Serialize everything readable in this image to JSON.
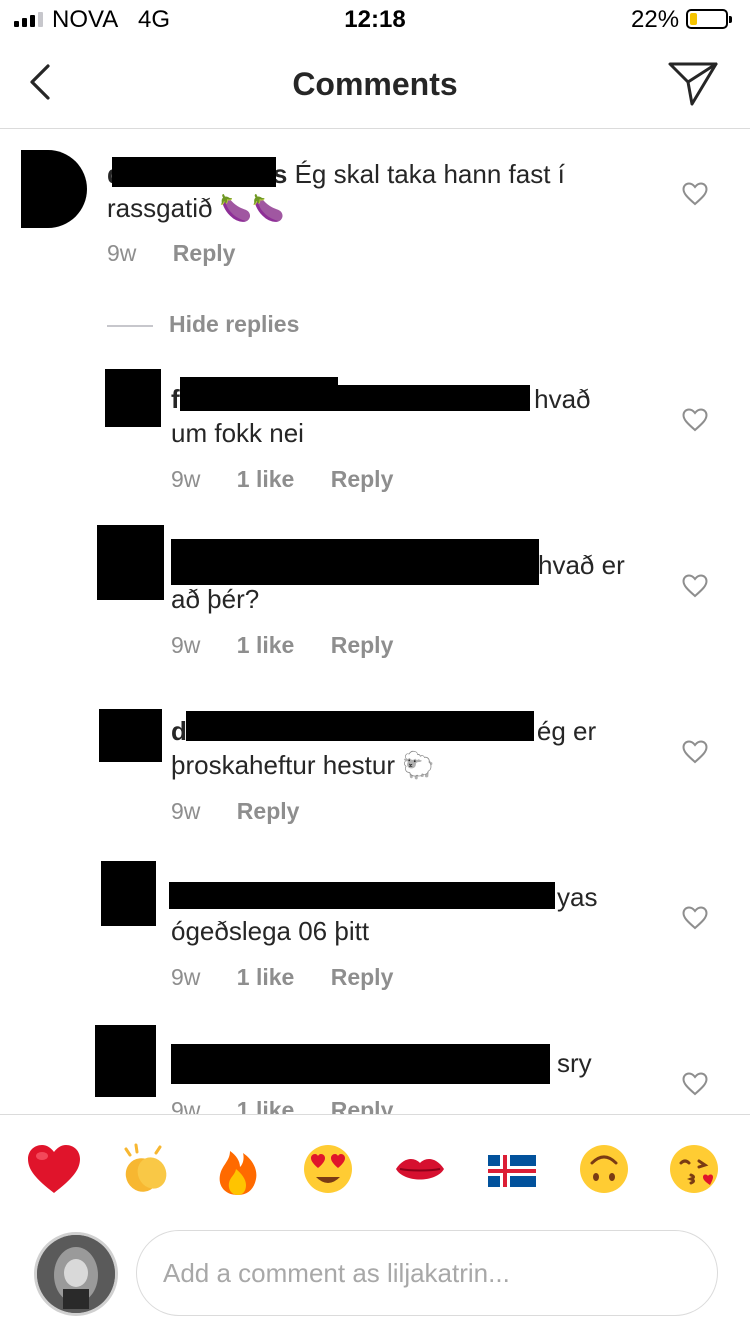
{
  "status_bar": {
    "carrier": "NOVA",
    "network": "4G",
    "time": "12:18",
    "battery_percent_label": "22%",
    "battery_level": 0.22,
    "battery_color": "#f5c400"
  },
  "header": {
    "title": "Comments",
    "back_icon": "chevron-left-icon",
    "share_icon": "paper-plane-icon"
  },
  "thread": {
    "parent": {
      "username_visible": "d",
      "username_tail": "s",
      "text_line1": "Ég skal taka hann fast í",
      "text_line2": "rassgatið 🍆🍆",
      "age": "9w",
      "reply_label": "Reply"
    },
    "hide_replies_label": "Hide replies",
    "replies": [
      {
        "username_visible": "fa",
        "text_line1": "hvað",
        "text_line2": "um fokk nei",
        "age": "9w",
        "likes": "1 like",
        "reply_label": "Reply"
      },
      {
        "username_visible": "",
        "text_line1": "hvað er",
        "text_line2": "að þér?",
        "age": "9w",
        "likes": "1 like",
        "reply_label": "Reply"
      },
      {
        "username_visible": "d",
        "text_line1": "ég er",
        "text_line2": "þroskaheftur hestur 🐑",
        "age": "9w",
        "likes": "",
        "reply_label": "Reply"
      },
      {
        "username_visible": "",
        "text_line1": "yas",
        "text_line2": "ógeðslega 06 þitt",
        "age": "9w",
        "likes": "1 like",
        "reply_label": "Reply"
      },
      {
        "username_visible": "",
        "text_line1": "sry",
        "text_line2": "",
        "age": "9w",
        "likes": "1 like",
        "reply_label": "Reply"
      }
    ]
  },
  "emoji_bar": [
    "❤️",
    "👏",
    "🔥",
    "😍",
    "💋",
    "🇮🇸",
    "🙃",
    "😘"
  ],
  "composer": {
    "placeholder": "Add a comment as liljakatrin..."
  },
  "colors": {
    "text": "#262626",
    "muted": "#8e8e8e",
    "divider": "#dbdbdb"
  }
}
